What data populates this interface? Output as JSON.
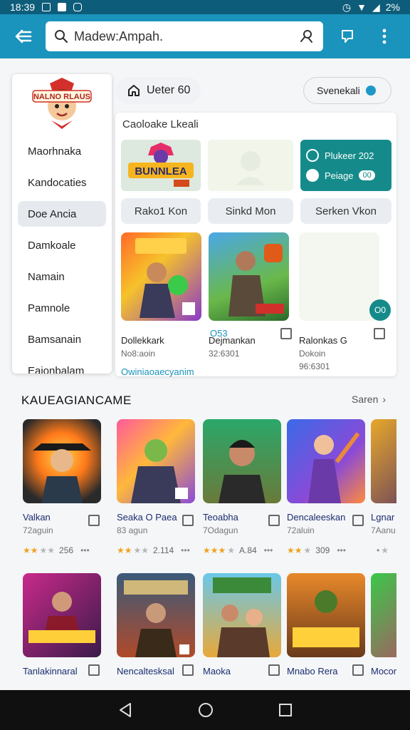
{
  "status_bar": {
    "time": "18:39",
    "battery": "2%"
  },
  "search": {
    "text": "Madew:Ampah."
  },
  "side_menu": {
    "logo_text": "NALNO RLAUS",
    "items": [
      {
        "label": "Maorhnaka"
      },
      {
        "label": "Kandocaties"
      },
      {
        "label": "Doe Ancia",
        "active": true
      },
      {
        "label": "Damkoale"
      },
      {
        "label": "Namain"
      },
      {
        "label": "Pamnole"
      },
      {
        "label": "Bamsanain"
      },
      {
        "label": "Eaionbalam"
      }
    ]
  },
  "chips": {
    "left_label": "Ueter 60",
    "right_label": "Svenekali"
  },
  "featured": {
    "title": "Caoloake Lkeali",
    "banner_text": "BUNNLEA",
    "options": [
      {
        "label": "Plukeer 202",
        "checked": false
      },
      {
        "label": "Peiage",
        "badge": "00",
        "checked": true
      }
    ],
    "tabs": [
      "Rako1 Kon",
      "Sinkd Mon",
      "Serken Vkon"
    ],
    "games": [
      {
        "number": "",
        "name": "Dollekkark",
        "meta": "No8:aoin"
      },
      {
        "number": "O53",
        "name": "Dejmankan",
        "meta": "32:6301"
      },
      {
        "number": "",
        "name": "Ralonkas G",
        "meta": "Dokoin",
        "meta2": "96:6301"
      }
    ],
    "fab_label": "O0",
    "link_text": "Owiniaoaecyanim"
  },
  "section": {
    "title": "KAUEAGIANCAME",
    "see_all": "Saren"
  },
  "grid": [
    {
      "name": "Valkan",
      "meta": "72aguin",
      "rating": 2,
      "score": "256"
    },
    {
      "name": "Seaka O Paea",
      "meta": "83 agun",
      "rating": 2,
      "score": "2.114"
    },
    {
      "name": "Teoabha",
      "meta": "7Odagun",
      "rating": 3,
      "score": "A.84"
    },
    {
      "name": "Dencaleeskan",
      "meta": "72aluin",
      "rating": 2,
      "score": "309"
    },
    {
      "name": "Lgnar",
      "meta": "7Aanu",
      "rating": 0,
      "score": ""
    },
    {
      "name": "Tanlakinnaral",
      "meta": "",
      "rating": 0,
      "score": ""
    },
    {
      "name": "Nencaltesksal",
      "meta": "",
      "rating": 0,
      "score": ""
    },
    {
      "name": "Maoka",
      "meta": "",
      "rating": 0,
      "score": ""
    },
    {
      "name": "Mnabo Rera",
      "meta": "",
      "rating": 0,
      "score": ""
    },
    {
      "name": "Mocor",
      "meta": "",
      "rating": 0,
      "score": ""
    }
  ],
  "colors": {
    "app_bar": "#1a93bd",
    "status_bar": "#0d5d7a",
    "teal": "#148b8a",
    "accent_blue": "#1e98c6"
  }
}
